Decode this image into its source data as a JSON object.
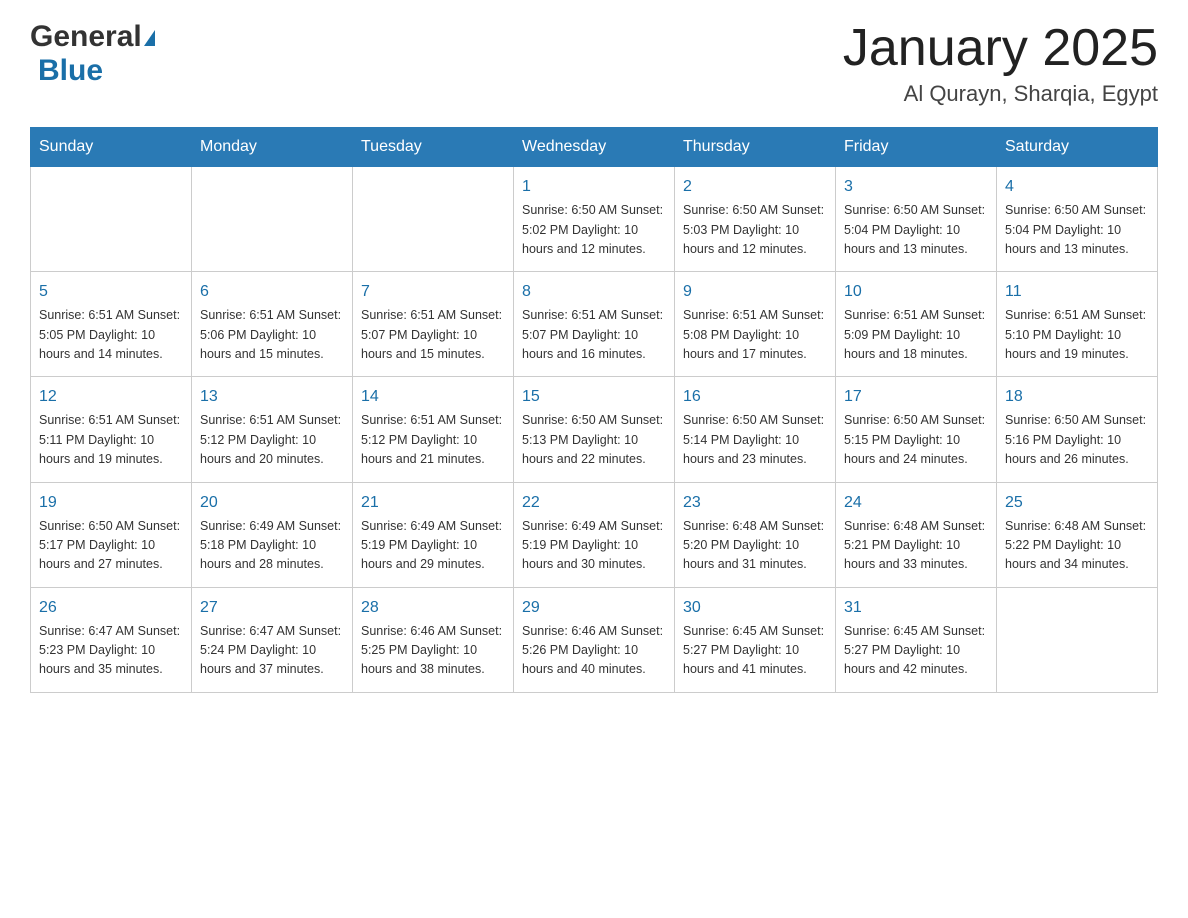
{
  "header": {
    "logo_general": "General",
    "logo_blue": "Blue",
    "month_title": "January 2025",
    "location": "Al Qurayn, Sharqia, Egypt"
  },
  "weekdays": [
    "Sunday",
    "Monday",
    "Tuesday",
    "Wednesday",
    "Thursday",
    "Friday",
    "Saturday"
  ],
  "weeks": [
    [
      {
        "day": "",
        "info": ""
      },
      {
        "day": "",
        "info": ""
      },
      {
        "day": "",
        "info": ""
      },
      {
        "day": "1",
        "info": "Sunrise: 6:50 AM\nSunset: 5:02 PM\nDaylight: 10 hours\nand 12 minutes."
      },
      {
        "day": "2",
        "info": "Sunrise: 6:50 AM\nSunset: 5:03 PM\nDaylight: 10 hours\nand 12 minutes."
      },
      {
        "day": "3",
        "info": "Sunrise: 6:50 AM\nSunset: 5:04 PM\nDaylight: 10 hours\nand 13 minutes."
      },
      {
        "day": "4",
        "info": "Sunrise: 6:50 AM\nSunset: 5:04 PM\nDaylight: 10 hours\nand 13 minutes."
      }
    ],
    [
      {
        "day": "5",
        "info": "Sunrise: 6:51 AM\nSunset: 5:05 PM\nDaylight: 10 hours\nand 14 minutes."
      },
      {
        "day": "6",
        "info": "Sunrise: 6:51 AM\nSunset: 5:06 PM\nDaylight: 10 hours\nand 15 minutes."
      },
      {
        "day": "7",
        "info": "Sunrise: 6:51 AM\nSunset: 5:07 PM\nDaylight: 10 hours\nand 15 minutes."
      },
      {
        "day": "8",
        "info": "Sunrise: 6:51 AM\nSunset: 5:07 PM\nDaylight: 10 hours\nand 16 minutes."
      },
      {
        "day": "9",
        "info": "Sunrise: 6:51 AM\nSunset: 5:08 PM\nDaylight: 10 hours\nand 17 minutes."
      },
      {
        "day": "10",
        "info": "Sunrise: 6:51 AM\nSunset: 5:09 PM\nDaylight: 10 hours\nand 18 minutes."
      },
      {
        "day": "11",
        "info": "Sunrise: 6:51 AM\nSunset: 5:10 PM\nDaylight: 10 hours\nand 19 minutes."
      }
    ],
    [
      {
        "day": "12",
        "info": "Sunrise: 6:51 AM\nSunset: 5:11 PM\nDaylight: 10 hours\nand 19 minutes."
      },
      {
        "day": "13",
        "info": "Sunrise: 6:51 AM\nSunset: 5:12 PM\nDaylight: 10 hours\nand 20 minutes."
      },
      {
        "day": "14",
        "info": "Sunrise: 6:51 AM\nSunset: 5:12 PM\nDaylight: 10 hours\nand 21 minutes."
      },
      {
        "day": "15",
        "info": "Sunrise: 6:50 AM\nSunset: 5:13 PM\nDaylight: 10 hours\nand 22 minutes."
      },
      {
        "day": "16",
        "info": "Sunrise: 6:50 AM\nSunset: 5:14 PM\nDaylight: 10 hours\nand 23 minutes."
      },
      {
        "day": "17",
        "info": "Sunrise: 6:50 AM\nSunset: 5:15 PM\nDaylight: 10 hours\nand 24 minutes."
      },
      {
        "day": "18",
        "info": "Sunrise: 6:50 AM\nSunset: 5:16 PM\nDaylight: 10 hours\nand 26 minutes."
      }
    ],
    [
      {
        "day": "19",
        "info": "Sunrise: 6:50 AM\nSunset: 5:17 PM\nDaylight: 10 hours\nand 27 minutes."
      },
      {
        "day": "20",
        "info": "Sunrise: 6:49 AM\nSunset: 5:18 PM\nDaylight: 10 hours\nand 28 minutes."
      },
      {
        "day": "21",
        "info": "Sunrise: 6:49 AM\nSunset: 5:19 PM\nDaylight: 10 hours\nand 29 minutes."
      },
      {
        "day": "22",
        "info": "Sunrise: 6:49 AM\nSunset: 5:19 PM\nDaylight: 10 hours\nand 30 minutes."
      },
      {
        "day": "23",
        "info": "Sunrise: 6:48 AM\nSunset: 5:20 PM\nDaylight: 10 hours\nand 31 minutes."
      },
      {
        "day": "24",
        "info": "Sunrise: 6:48 AM\nSunset: 5:21 PM\nDaylight: 10 hours\nand 33 minutes."
      },
      {
        "day": "25",
        "info": "Sunrise: 6:48 AM\nSunset: 5:22 PM\nDaylight: 10 hours\nand 34 minutes."
      }
    ],
    [
      {
        "day": "26",
        "info": "Sunrise: 6:47 AM\nSunset: 5:23 PM\nDaylight: 10 hours\nand 35 minutes."
      },
      {
        "day": "27",
        "info": "Sunrise: 6:47 AM\nSunset: 5:24 PM\nDaylight: 10 hours\nand 37 minutes."
      },
      {
        "day": "28",
        "info": "Sunrise: 6:46 AM\nSunset: 5:25 PM\nDaylight: 10 hours\nand 38 minutes."
      },
      {
        "day": "29",
        "info": "Sunrise: 6:46 AM\nSunset: 5:26 PM\nDaylight: 10 hours\nand 40 minutes."
      },
      {
        "day": "30",
        "info": "Sunrise: 6:45 AM\nSunset: 5:27 PM\nDaylight: 10 hours\nand 41 minutes."
      },
      {
        "day": "31",
        "info": "Sunrise: 6:45 AM\nSunset: 5:27 PM\nDaylight: 10 hours\nand 42 minutes."
      },
      {
        "day": "",
        "info": ""
      }
    ]
  ]
}
